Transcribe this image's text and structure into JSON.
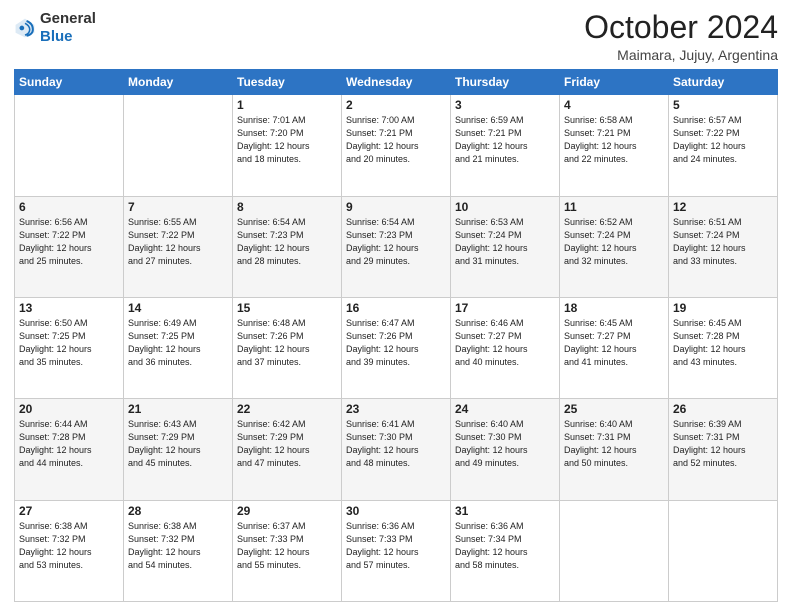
{
  "header": {
    "logo_general": "General",
    "logo_blue": "Blue",
    "month_title": "October 2024",
    "subtitle": "Maimara, Jujuy, Argentina"
  },
  "weekdays": [
    "Sunday",
    "Monday",
    "Tuesday",
    "Wednesday",
    "Thursday",
    "Friday",
    "Saturday"
  ],
  "weeks": [
    [
      {
        "day": "",
        "info": ""
      },
      {
        "day": "",
        "info": ""
      },
      {
        "day": "1",
        "info": "Sunrise: 7:01 AM\nSunset: 7:20 PM\nDaylight: 12 hours\nand 18 minutes."
      },
      {
        "day": "2",
        "info": "Sunrise: 7:00 AM\nSunset: 7:21 PM\nDaylight: 12 hours\nand 20 minutes."
      },
      {
        "day": "3",
        "info": "Sunrise: 6:59 AM\nSunset: 7:21 PM\nDaylight: 12 hours\nand 21 minutes."
      },
      {
        "day": "4",
        "info": "Sunrise: 6:58 AM\nSunset: 7:21 PM\nDaylight: 12 hours\nand 22 minutes."
      },
      {
        "day": "5",
        "info": "Sunrise: 6:57 AM\nSunset: 7:22 PM\nDaylight: 12 hours\nand 24 minutes."
      }
    ],
    [
      {
        "day": "6",
        "info": "Sunrise: 6:56 AM\nSunset: 7:22 PM\nDaylight: 12 hours\nand 25 minutes."
      },
      {
        "day": "7",
        "info": "Sunrise: 6:55 AM\nSunset: 7:22 PM\nDaylight: 12 hours\nand 27 minutes."
      },
      {
        "day": "8",
        "info": "Sunrise: 6:54 AM\nSunset: 7:23 PM\nDaylight: 12 hours\nand 28 minutes."
      },
      {
        "day": "9",
        "info": "Sunrise: 6:54 AM\nSunset: 7:23 PM\nDaylight: 12 hours\nand 29 minutes."
      },
      {
        "day": "10",
        "info": "Sunrise: 6:53 AM\nSunset: 7:24 PM\nDaylight: 12 hours\nand 31 minutes."
      },
      {
        "day": "11",
        "info": "Sunrise: 6:52 AM\nSunset: 7:24 PM\nDaylight: 12 hours\nand 32 minutes."
      },
      {
        "day": "12",
        "info": "Sunrise: 6:51 AM\nSunset: 7:24 PM\nDaylight: 12 hours\nand 33 minutes."
      }
    ],
    [
      {
        "day": "13",
        "info": "Sunrise: 6:50 AM\nSunset: 7:25 PM\nDaylight: 12 hours\nand 35 minutes."
      },
      {
        "day": "14",
        "info": "Sunrise: 6:49 AM\nSunset: 7:25 PM\nDaylight: 12 hours\nand 36 minutes."
      },
      {
        "day": "15",
        "info": "Sunrise: 6:48 AM\nSunset: 7:26 PM\nDaylight: 12 hours\nand 37 minutes."
      },
      {
        "day": "16",
        "info": "Sunrise: 6:47 AM\nSunset: 7:26 PM\nDaylight: 12 hours\nand 39 minutes."
      },
      {
        "day": "17",
        "info": "Sunrise: 6:46 AM\nSunset: 7:27 PM\nDaylight: 12 hours\nand 40 minutes."
      },
      {
        "day": "18",
        "info": "Sunrise: 6:45 AM\nSunset: 7:27 PM\nDaylight: 12 hours\nand 41 minutes."
      },
      {
        "day": "19",
        "info": "Sunrise: 6:45 AM\nSunset: 7:28 PM\nDaylight: 12 hours\nand 43 minutes."
      }
    ],
    [
      {
        "day": "20",
        "info": "Sunrise: 6:44 AM\nSunset: 7:28 PM\nDaylight: 12 hours\nand 44 minutes."
      },
      {
        "day": "21",
        "info": "Sunrise: 6:43 AM\nSunset: 7:29 PM\nDaylight: 12 hours\nand 45 minutes."
      },
      {
        "day": "22",
        "info": "Sunrise: 6:42 AM\nSunset: 7:29 PM\nDaylight: 12 hours\nand 47 minutes."
      },
      {
        "day": "23",
        "info": "Sunrise: 6:41 AM\nSunset: 7:30 PM\nDaylight: 12 hours\nand 48 minutes."
      },
      {
        "day": "24",
        "info": "Sunrise: 6:40 AM\nSunset: 7:30 PM\nDaylight: 12 hours\nand 49 minutes."
      },
      {
        "day": "25",
        "info": "Sunrise: 6:40 AM\nSunset: 7:31 PM\nDaylight: 12 hours\nand 50 minutes."
      },
      {
        "day": "26",
        "info": "Sunrise: 6:39 AM\nSunset: 7:31 PM\nDaylight: 12 hours\nand 52 minutes."
      }
    ],
    [
      {
        "day": "27",
        "info": "Sunrise: 6:38 AM\nSunset: 7:32 PM\nDaylight: 12 hours\nand 53 minutes."
      },
      {
        "day": "28",
        "info": "Sunrise: 6:38 AM\nSunset: 7:32 PM\nDaylight: 12 hours\nand 54 minutes."
      },
      {
        "day": "29",
        "info": "Sunrise: 6:37 AM\nSunset: 7:33 PM\nDaylight: 12 hours\nand 55 minutes."
      },
      {
        "day": "30",
        "info": "Sunrise: 6:36 AM\nSunset: 7:33 PM\nDaylight: 12 hours\nand 57 minutes."
      },
      {
        "day": "31",
        "info": "Sunrise: 6:36 AM\nSunset: 7:34 PM\nDaylight: 12 hours\nand 58 minutes."
      },
      {
        "day": "",
        "info": ""
      },
      {
        "day": "",
        "info": ""
      }
    ]
  ]
}
